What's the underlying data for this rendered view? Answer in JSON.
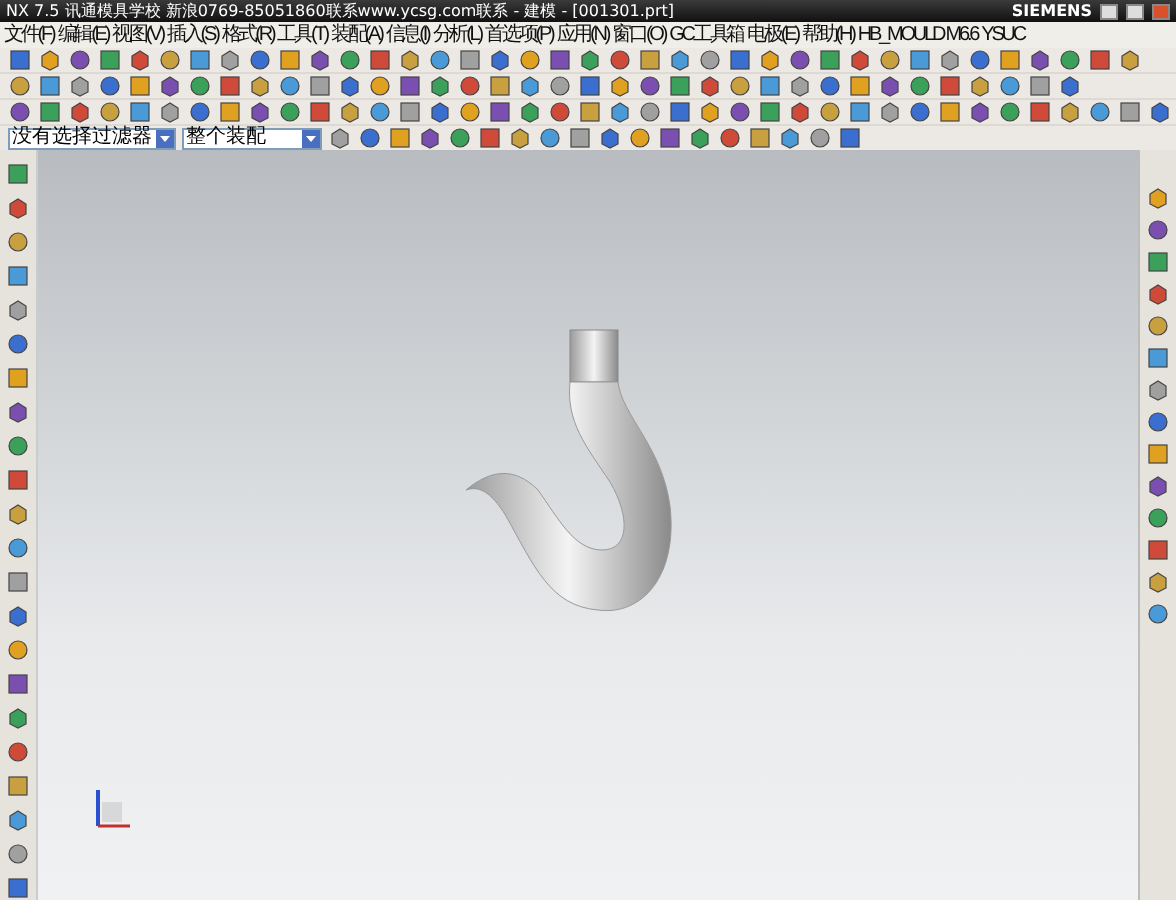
{
  "window": {
    "title": "NX 7.5 讯通模具学校 新浪0769-85051860联系www.ycsg.com联系 - 建模 - [001301.prt]",
    "brand": "SIEMENS"
  },
  "menu": [
    "文件(F)",
    "编辑(E)",
    "视图(V)",
    "插入(S)",
    "格式(R)",
    "工具(T)",
    "装配(A)",
    "信息(I)",
    "分析(L)",
    "首选项(P)",
    "应用(N)",
    "窗口(O)",
    "GC工具箱",
    "电极(E)",
    "帮助(H)",
    "HB_MOULD M6.6",
    "YSUC"
  ],
  "selection_bar": {
    "filter": "没有选择过滤器",
    "scope": "整个装配"
  }
}
